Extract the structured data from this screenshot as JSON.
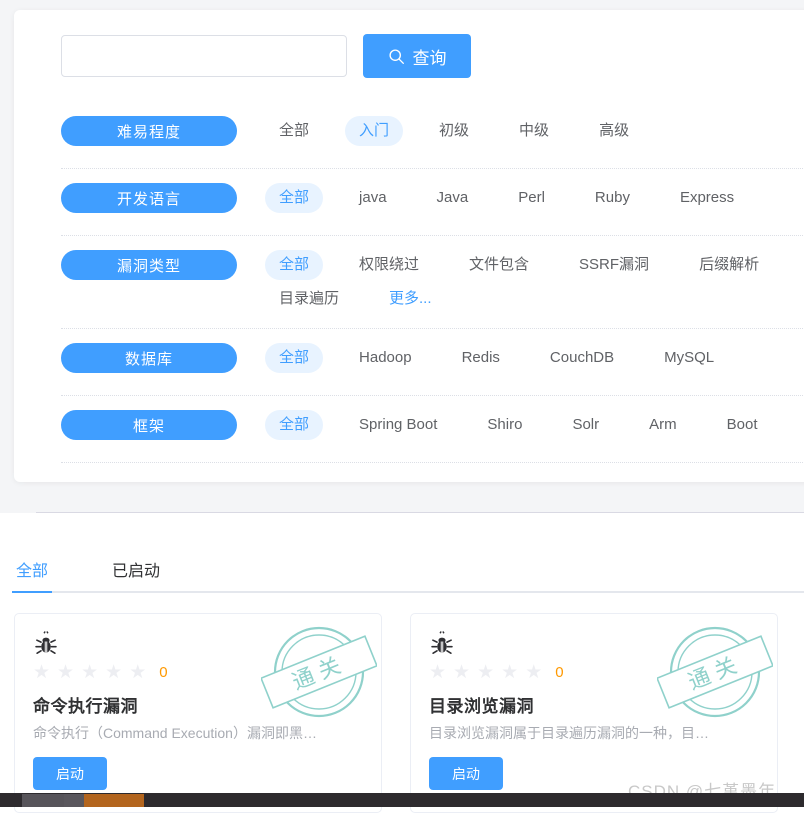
{
  "search": {
    "value": "",
    "placeholder": "",
    "button_label": "查询",
    "icon": "search-icon"
  },
  "filters": [
    {
      "category": "难易程度",
      "options": [
        {
          "label": "全部",
          "active": false
        },
        {
          "label": "入门",
          "active": true
        },
        {
          "label": "初级",
          "active": false
        },
        {
          "label": "中级",
          "active": false
        },
        {
          "label": "高级",
          "active": false
        }
      ]
    },
    {
      "category": "开发语言",
      "options": [
        {
          "label": "全部",
          "active": true
        },
        {
          "label": "java",
          "active": false
        },
        {
          "label": "Java",
          "active": false
        },
        {
          "label": "Perl",
          "active": false
        },
        {
          "label": "Ruby",
          "active": false
        },
        {
          "label": "Express",
          "active": false
        }
      ]
    },
    {
      "category": "漏洞类型",
      "options": [
        {
          "label": "全部",
          "active": true
        },
        {
          "label": "权限绕过",
          "active": false
        },
        {
          "label": "文件包含",
          "active": false
        },
        {
          "label": "SSRF漏洞",
          "active": false
        },
        {
          "label": "后缀解析",
          "active": false
        },
        {
          "label": "目录遍历",
          "active": false
        },
        {
          "label": "更多...",
          "active": false,
          "more": true
        }
      ]
    },
    {
      "category": "数据库",
      "options": [
        {
          "label": "全部",
          "active": true
        },
        {
          "label": "Hadoop",
          "active": false
        },
        {
          "label": "Redis",
          "active": false
        },
        {
          "label": "CouchDB",
          "active": false
        },
        {
          "label": "MySQL",
          "active": false
        }
      ]
    },
    {
      "category": "框架",
      "options": [
        {
          "label": "全部",
          "active": true
        },
        {
          "label": "Spring Boot",
          "active": false
        },
        {
          "label": "Shiro",
          "active": false
        },
        {
          "label": "Solr",
          "active": false
        },
        {
          "label": "Arm",
          "active": false
        },
        {
          "label": "Boot",
          "active": false
        }
      ]
    }
  ],
  "tabs": [
    {
      "label": "全部",
      "active": true
    },
    {
      "label": "已启动",
      "active": false
    }
  ],
  "cards": [
    {
      "icon": "bug-icon",
      "stars": 5,
      "stars_filled": 0,
      "rating": "0",
      "title": "命令执行漏洞",
      "desc": "命令执行（Command Execution）漏洞即黑…",
      "button_label": "启动",
      "stamp_text": "通关"
    },
    {
      "icon": "bug-icon",
      "stars": 5,
      "stars_filled": 0,
      "rating": "0",
      "title": "目录浏览漏洞",
      "desc": "目录浏览漏洞属于目录遍历漏洞的一种，目…",
      "button_label": "启动",
      "stamp_text": "通关"
    }
  ],
  "watermark": "CSDN @七堇墨年",
  "colors": {
    "accent": "#409eff",
    "accent_soft": "#e8f3ff",
    "rating": "#ff9900",
    "stamp": "#8fd1cb",
    "text": "#303133",
    "muted": "#a8abb2",
    "page_bg": "#f4f5f7"
  }
}
